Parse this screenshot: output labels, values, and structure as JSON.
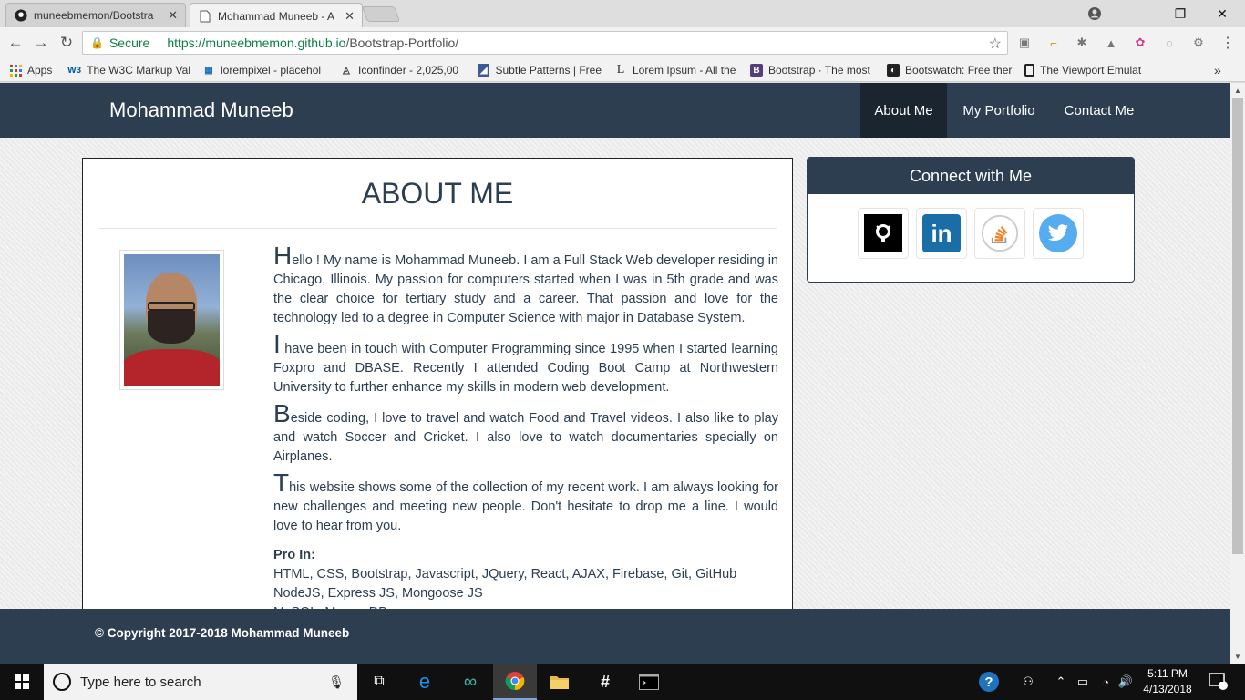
{
  "browser": {
    "tabs": [
      {
        "title": "muneebmemon/Bootstra",
        "icon": "github-icon"
      },
      {
        "title": "Mohammad Muneeb - A",
        "icon": "document-icon"
      }
    ],
    "security_label": "Secure",
    "url_host": "https://muneebmemon.github.io",
    "url_path": "/Bootstrap-Portfolio/",
    "bookmarks": [
      {
        "label": "Apps"
      },
      {
        "label": "The W3C Markup Val"
      },
      {
        "label": "lorempixel - placehol"
      },
      {
        "label": "Iconfinder - 2,025,00"
      },
      {
        "label": "Subtle Patterns | Free"
      },
      {
        "label": "Lorem Ipsum - All the"
      },
      {
        "label": "Bootstrap · The most"
      },
      {
        "label": "Bootswatch: Free ther"
      },
      {
        "label": "The Viewport Emulat"
      }
    ],
    "overflow": "»"
  },
  "site": {
    "brand": "Mohammad Muneeb",
    "nav": [
      {
        "label": "About Me",
        "active": true
      },
      {
        "label": "My Portfolio",
        "active": false
      },
      {
        "label": "Contact Me",
        "active": false
      }
    ],
    "about": {
      "title": "ABOUT ME",
      "paragraphs": [
        {
          "cap": "H",
          "rest": "ello ! My name is Mohammad Muneeb. I am a Full Stack Web developer residing in Chicago, Illinois. My passion for computers started when I was in 5th grade and was the clear choice for tertiary study and a career. That passion and love for the technology led to a degree in Computer Science with major in Database System."
        },
        {
          "cap": "I",
          "rest": " have been in touch with Computer Programming since 1995 when I started learning Foxpro and DBASE. Recently I attended Coding Boot Camp at Northwestern University to further enhance my skills in modern web development."
        },
        {
          "cap": "B",
          "rest": "eside coding, I love to travel and watch Food and Travel videos. I also like to play and watch Soccer and Cricket. I also love to watch documentaries specially on Airplanes."
        },
        {
          "cap": "T",
          "rest": "his website shows some of the collection of my recent work. I am always looking for new challenges and meeting new people. Don't hesitate to drop me a line. I would love to hear from you."
        }
      ],
      "pro_label": "Pro In:",
      "pro_lines": [
        "HTML, CSS, Bootstrap, Javascript, JQuery, React, AJAX, Firebase, Git, GitHub",
        "NodeJS, Express JS, Mongoose JS",
        "MySQL, Mongo DB"
      ]
    },
    "connect": {
      "title": "Connect with Me",
      "links": [
        "github-icon",
        "linkedin-icon",
        "stackoverflow-icon",
        "twitter-icon"
      ],
      "linkedin_glyph": "in"
    },
    "footer": "© Copyright 2017-2018 Mohammad Muneeb"
  },
  "taskbar": {
    "search_placeholder": "Type here to search",
    "time": "5:11 PM",
    "date": "4/13/2018",
    "notification_count": "1"
  },
  "colors": {
    "navbar": "#2c3e50",
    "navbar_active": "#1a252f",
    "secure_green": "#0b8043"
  }
}
